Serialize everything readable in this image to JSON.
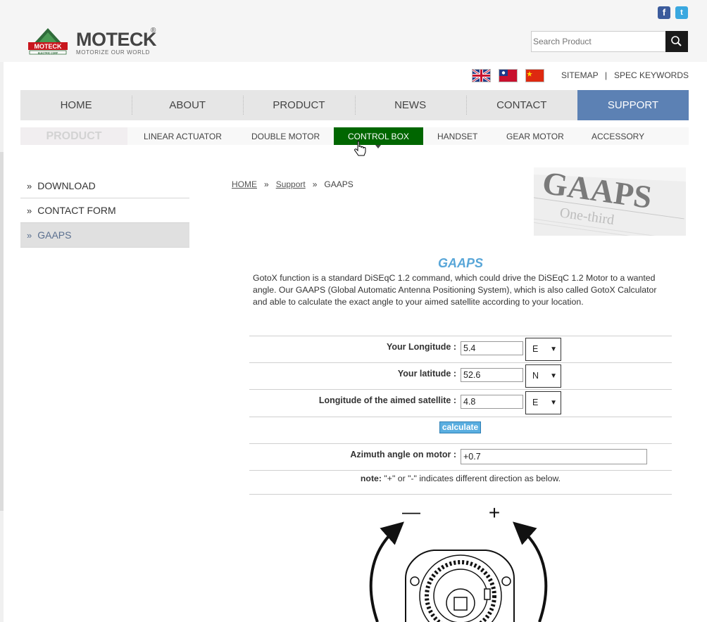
{
  "header": {
    "brand_name": "MOTECK",
    "brand_reg": "®",
    "brand_tagline": "MOTORIZE OUR WORLD",
    "logo_mark_text": "MOTECK",
    "logo_mark_sub": "ELECTRIC CORP",
    "social": {
      "facebook_glyph": "f",
      "twitter_glyph": "t"
    },
    "search": {
      "placeholder": "Search Product"
    }
  },
  "utility": {
    "sitemap": "SITEMAP",
    "divider": "|",
    "spec_keywords": "SPEC KEYWORDS"
  },
  "main_nav": [
    {
      "label": "HOME"
    },
    {
      "label": "ABOUT"
    },
    {
      "label": "PRODUCT"
    },
    {
      "label": "NEWS"
    },
    {
      "label": "CONTACT"
    },
    {
      "label": "SUPPORT",
      "active": true
    }
  ],
  "sub_nav": {
    "product_label": "PRODUCT",
    "items": [
      {
        "label": "LINEAR ACTUATOR"
      },
      {
        "label": "DOUBLE MOTOR"
      },
      {
        "label": "CONTROL BOX",
        "active": true
      },
      {
        "label": "HANDSET"
      },
      {
        "label": "GEAR MOTOR"
      },
      {
        "label": "ACCESSORY"
      }
    ]
  },
  "sidebar": {
    "marker": "»",
    "items": [
      {
        "label": "DOWNLOAD"
      },
      {
        "label": "CONTACT FORM"
      },
      {
        "label": "GAAPS",
        "active": true
      }
    ]
  },
  "breadcrumb": {
    "home": "HOME",
    "sep": "»",
    "support": "Support",
    "current": "GAAPS"
  },
  "banner": {
    "text": "GAAPS",
    "subtext": "One-third"
  },
  "content": {
    "title": "GAAPS",
    "intro": "GotoX function is a standard DiSEqC 1.2 command, which could drive the DiSEqC 1.2 Motor to a wanted angle. Our GAAPS (Global Automatic Antenna Positioning System), which is also called GotoX Calculator and able to calculate the exact angle to your aimed satellite according to your location."
  },
  "form": {
    "longitude": {
      "label": "Your Longitude :",
      "value": "5.4",
      "dir": "E"
    },
    "latitude": {
      "label": "Your latitude :",
      "value": "52.6",
      "dir": "N"
    },
    "satellite": {
      "label": "Longitude of the aimed satellite :",
      "value": "4.8",
      "dir": "E"
    },
    "select_arrow": "▼",
    "calculate_label": "calculate",
    "azimuth": {
      "label": "Azimuth angle on motor :",
      "value": "+0.7"
    },
    "note_label": "note:",
    "note_text": " \"+\" or \"-\" indicates different direction as below."
  },
  "diagram": {
    "minus": "—",
    "plus": "+"
  },
  "colors": {
    "accent_blue": "#5c81b4",
    "active_green": "#006600",
    "title_blue": "#58a6d8",
    "calc_button": "#5aaee0"
  }
}
